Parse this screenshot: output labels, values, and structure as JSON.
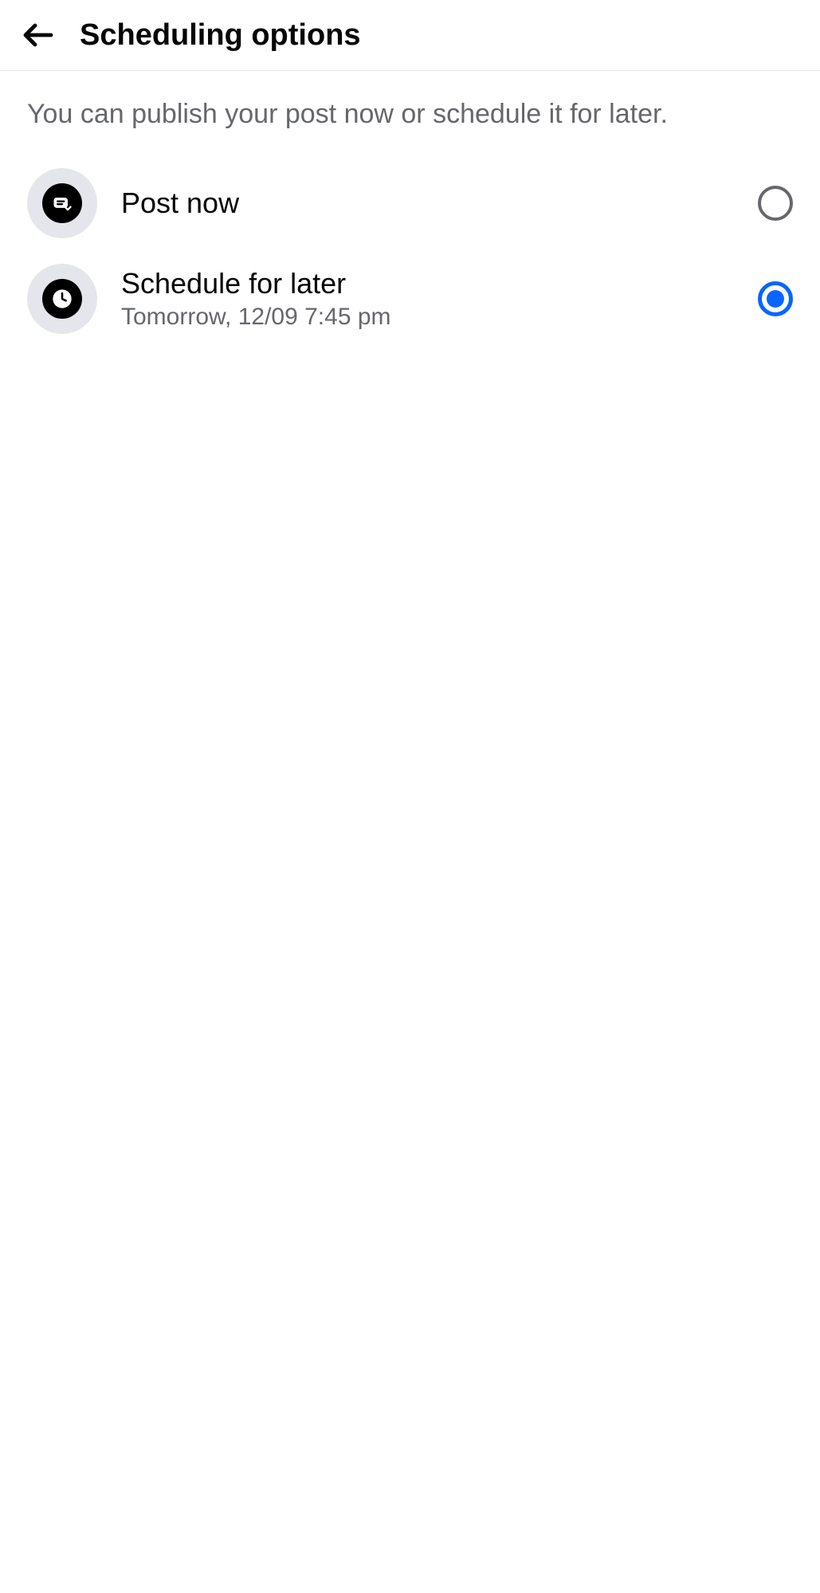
{
  "header": {
    "title": "Scheduling options"
  },
  "description": "You can publish your post now or schedule it for later.",
  "options": {
    "post_now": {
      "title": "Post now",
      "selected": false
    },
    "schedule_later": {
      "title": "Schedule for later",
      "subtitle": "Tomorrow, 12/09 7:45 pm",
      "selected": true
    }
  }
}
